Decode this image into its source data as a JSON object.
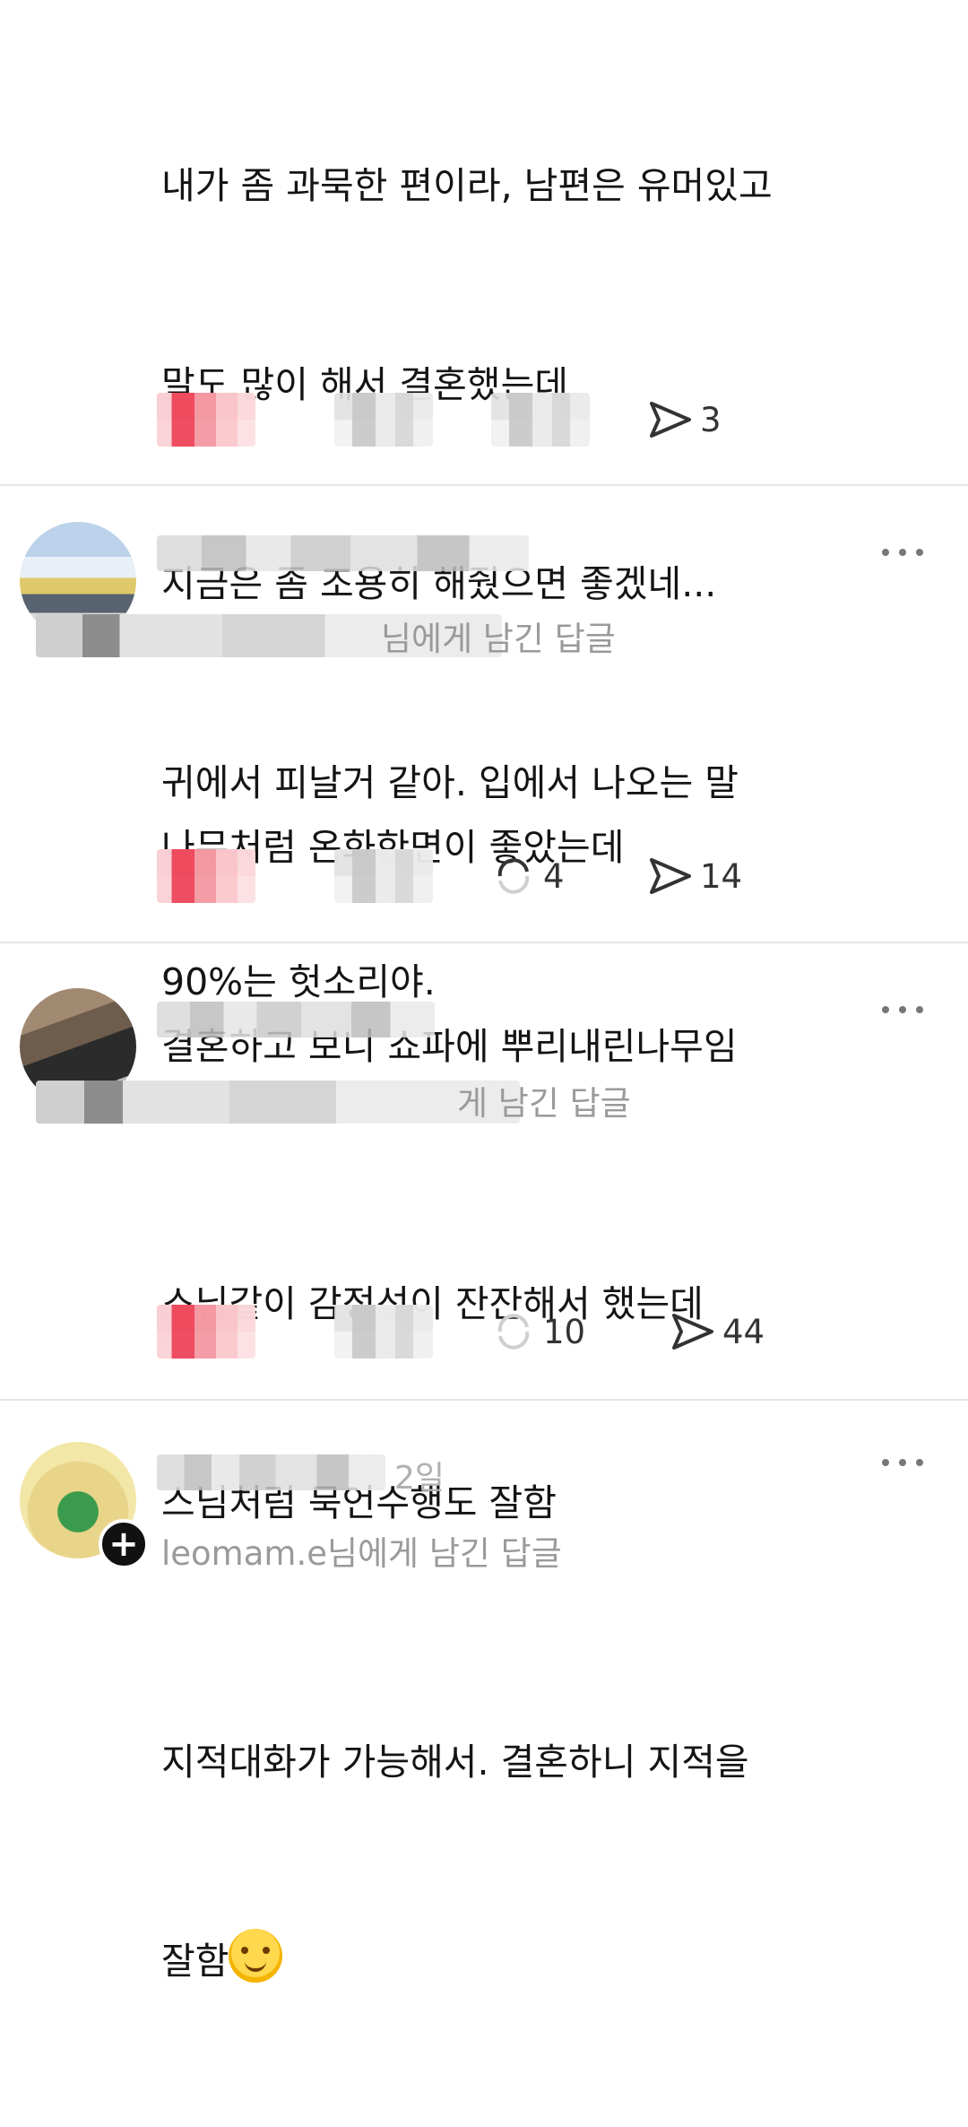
{
  "posts": [
    {
      "text_lines": [
        "내가 좀 과묵한 편이라, 남편은 유머있고",
        "말도 많이 해서 결혼했는데",
        "지금은 좀 조용히 해줬으면 좋겠네...",
        "귀에서 피날거 같아. 입에서 나오는 말",
        "90%는 헛소리야."
      ],
      "share_count": "3"
    },
    {
      "reply_to": "님에게 남긴 답글",
      "text_lines": [
        "나무처럼 온화한면이 좋았는데",
        "결혼하고 보니 쇼파에 뿌리내린나무임"
      ],
      "repost_count": "4",
      "share_count": "14"
    },
    {
      "reply_to": "게 남긴 답글",
      "text_lines": [
        "스님같이 감정선이 잔잔해서 했는데",
        "스님처럼 묵언수행도 잘함"
      ],
      "repost_count": "10",
      "share_count": "44"
    },
    {
      "time": "2일",
      "reply_to": "leomam.e님에게 남긴 답글",
      "text_lines": [
        "지적대화가 가능해서. 결혼하니 지적을",
        "잘함"
      ],
      "emoji": "hugging-face-emoji"
    }
  ],
  "colors": {
    "like_red": "#ee465a",
    "divider": "#e6e6e6",
    "muted_text": "#9a9a9a"
  }
}
